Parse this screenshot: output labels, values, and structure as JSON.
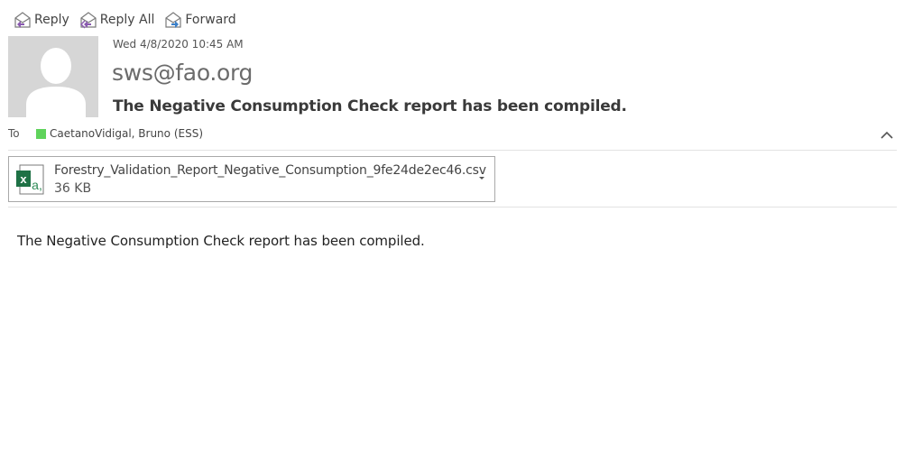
{
  "toolbar": {
    "reply_label": "Reply",
    "reply_all_label": "Reply All",
    "forward_label": "Forward"
  },
  "message": {
    "date": "Wed 4/8/2020 10:45 AM",
    "sender": "sws@fao.org",
    "subject": "The Negative Consumption Check report has been compiled.",
    "to_label": "To",
    "recipient": "CaetanoVidigal, Bruno (ESS)",
    "presence_color": "#5fd35b"
  },
  "attachment": {
    "filename": "Forestry_Validation_Report_Negative_Consumption_9fe24de2ec46.csv",
    "size": "36 KB",
    "icon": "excel-csv-icon",
    "icon_letter": "x",
    "icon_sub_letter": "a,"
  },
  "body": {
    "text": "The Negative Consumption Check report has been compiled."
  }
}
